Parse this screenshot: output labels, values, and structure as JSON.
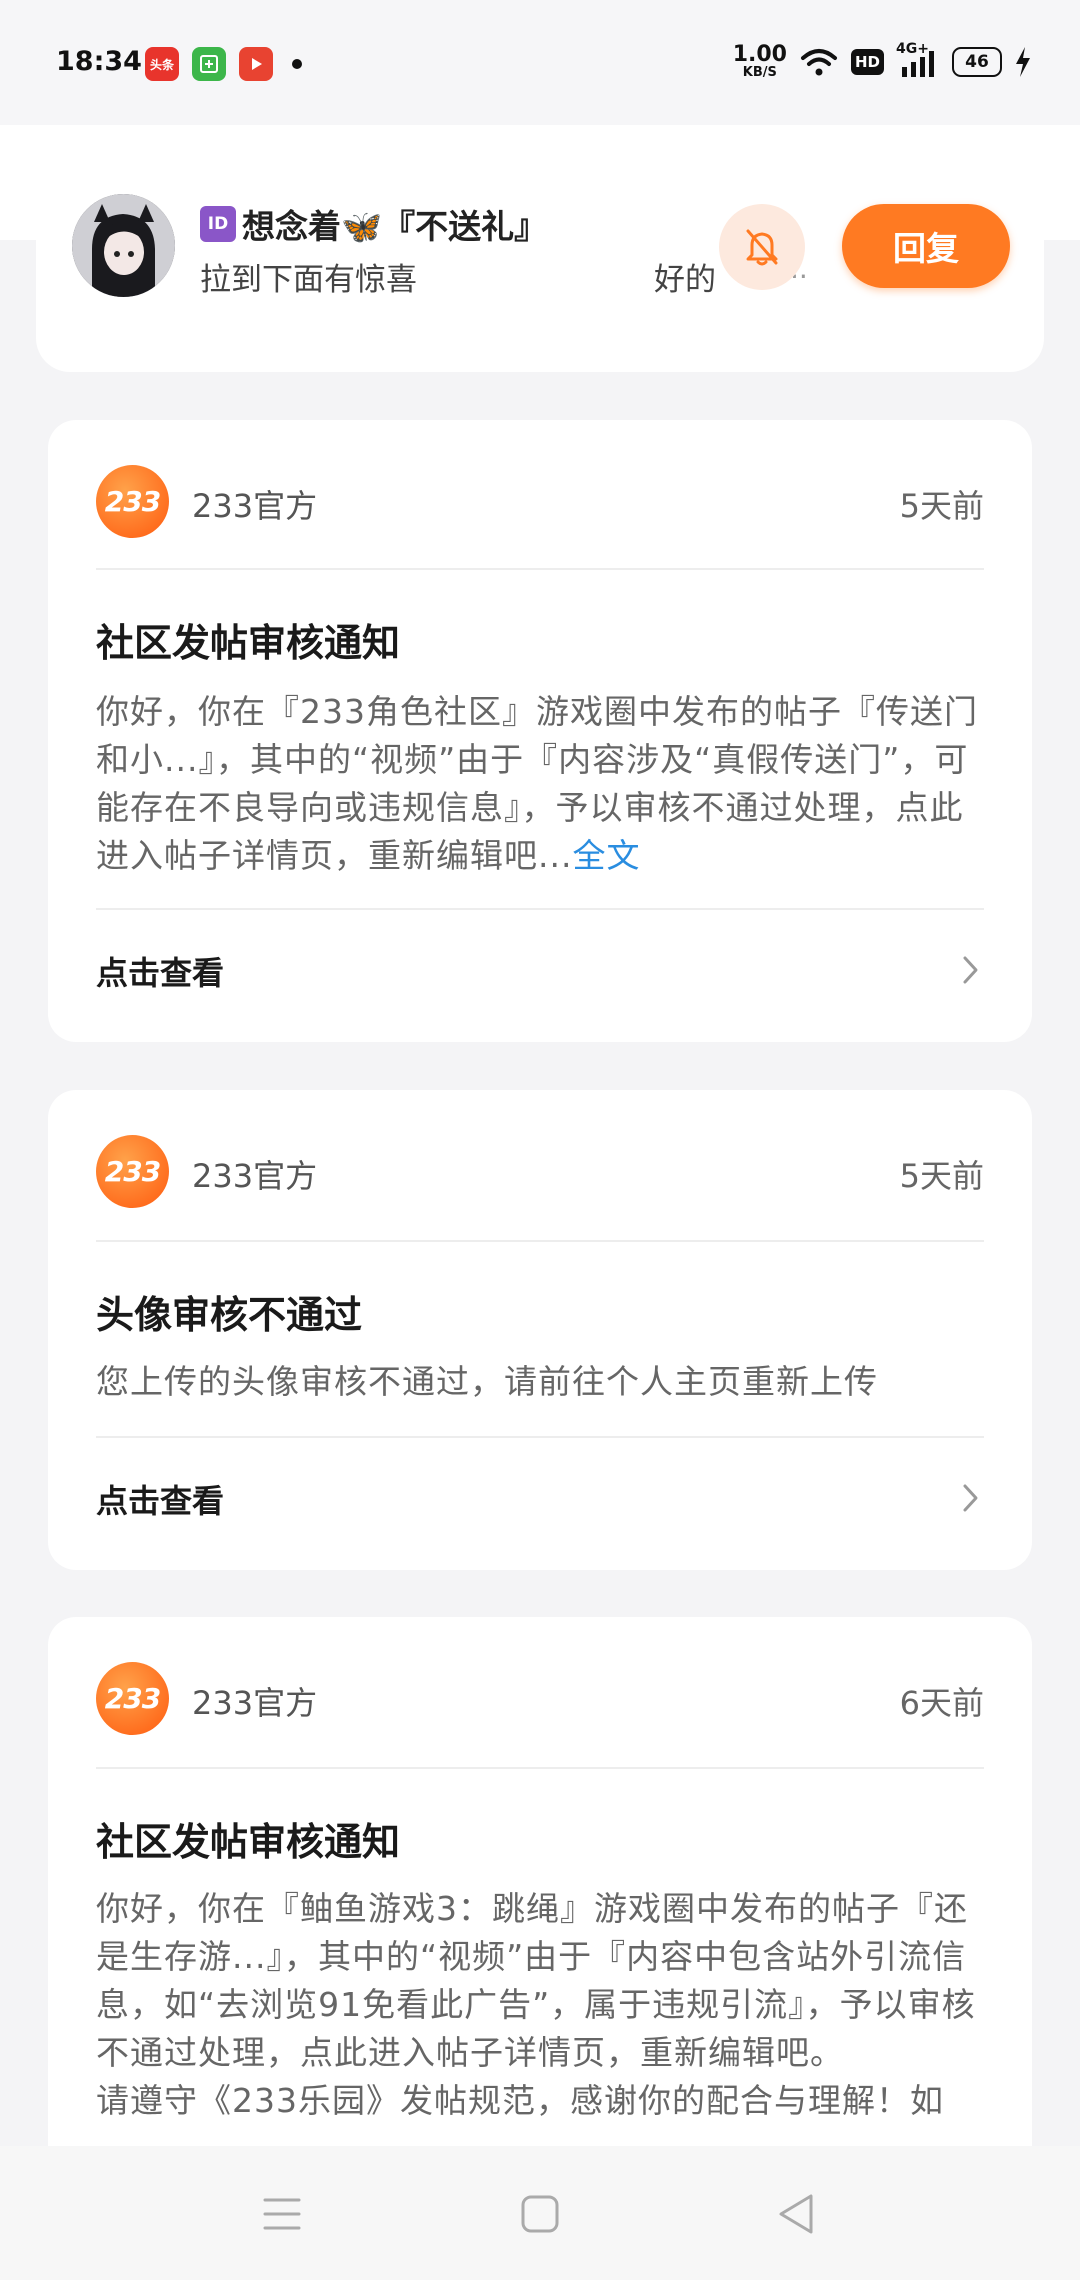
{
  "status_bar": {
    "time": "18:34",
    "app_icons": [
      {
        "name": "toutiao-icon",
        "label": "头条",
        "color": "#e8342c"
      },
      {
        "name": "calculator-icon",
        "label": "",
        "color": "#3cb64a"
      },
      {
        "name": "video-play-icon",
        "label": "",
        "color": "#e84331"
      }
    ],
    "net_speed_value": "1.00",
    "net_speed_unit": "KB/S",
    "hd_label": "HD",
    "network_label": "4G+",
    "battery_level": "46"
  },
  "banner": {
    "id_badge": "ID",
    "name": "想念着🦋『不送礼』",
    "message": "拉到下面有惊喜",
    "reply_preview": "好的",
    "dots": "..",
    "reply_button": "回复"
  },
  "cards": [
    {
      "logo_text": "233",
      "sender": "233官方",
      "time": "5天前",
      "title": "社区发帖审核通知",
      "body": "你好，你在『233角色社区』游戏圈中发布的帖子『传送门和小...』，其中的“视频”由于『内容涉及“真假传送门”，可能存在不良导向或违规信息』，予以审核不通过处理，点此进入帖子详情页，重新编辑吧...",
      "full_link": "全文",
      "view_label": "点击查看"
    },
    {
      "logo_text": "233",
      "sender": "233官方",
      "time": "5天前",
      "title": "头像审核不通过",
      "body": "您上传的头像审核不通过，请前往个人主页重新上传",
      "view_label": "点击查看"
    },
    {
      "logo_text": "233",
      "sender": "233官方",
      "time": "6天前",
      "title": "社区发帖审核通知",
      "body": "你好，你在『鲉鱼游戏3：跳绳』游戏圈中发布的帖子『还是生存游...』，其中的“视频”由于『内容中包含站外引流信息，如“去浏览91免看此广告”，属于违规引流』，予以审核不通过处理，点此进入帖子详情页，重新编辑吧。",
      "body_extra": "请遵守《233乐园》发帖规范，感谢你的配合与理解！如"
    }
  ],
  "colors": {
    "accent": "#ff7a22",
    "link": "#2a8de0",
    "background": "#f4f4f6"
  },
  "nav": {
    "menu_icon": "menu-icon",
    "home_icon": "home-square-icon",
    "back_icon": "back-triangle-icon"
  }
}
